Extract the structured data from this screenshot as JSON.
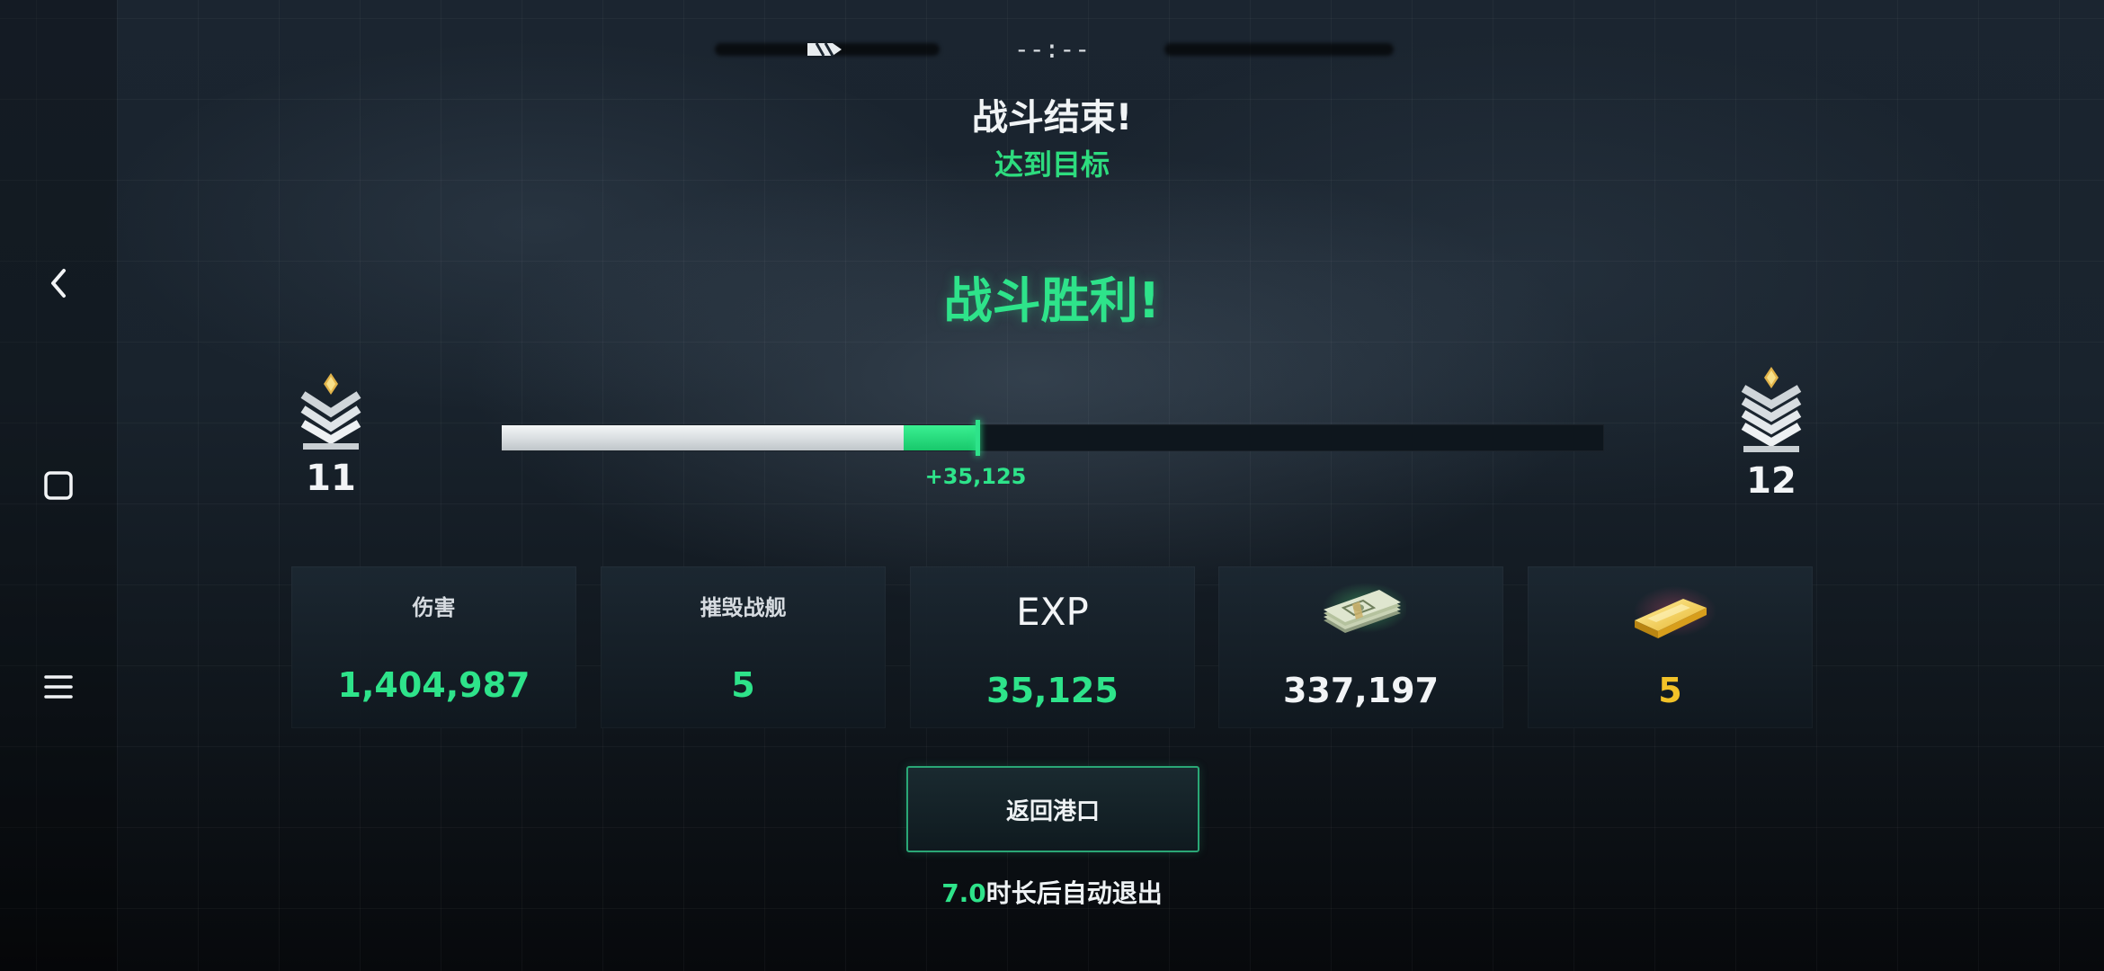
{
  "status_bar": {
    "clock": "--:--"
  },
  "header": {
    "title": "战斗结束!",
    "subtitle": "达到目标"
  },
  "result": {
    "victory_text": "战斗胜利!"
  },
  "progress": {
    "current_rank": "11",
    "next_rank": "12",
    "base_fraction": 0.365,
    "after_fraction": 0.432,
    "gain_label": "+35,125",
    "rank_icon": "chevron-rank-icon"
  },
  "stats": [
    {
      "label": "伤害",
      "value": "1,404,987",
      "value_color": "#2ee38a"
    },
    {
      "label": "摧毁战舰",
      "value": "5",
      "value_color": "#2ee38a"
    },
    {
      "label": "EXP",
      "value": "35,125",
      "value_color": "#2ee38a"
    },
    {
      "icon": "cash-stack-icon",
      "value": "337,197",
      "value_color": "#f2f4f6"
    },
    {
      "icon": "gold-bar-icon",
      "value": "5",
      "value_color": "#f2c228"
    }
  ],
  "actions": {
    "return_port": "返回港口"
  },
  "auto_exit": {
    "seconds": "7.0",
    "text": "时长后自动退出"
  },
  "nav": {
    "back_icon": "back-chevron-icon",
    "home_icon": "home-square-icon",
    "menu_icon": "menu-lines-icon"
  },
  "colors": {
    "accent_green": "#2ee38a",
    "gold": "#f2c228"
  }
}
